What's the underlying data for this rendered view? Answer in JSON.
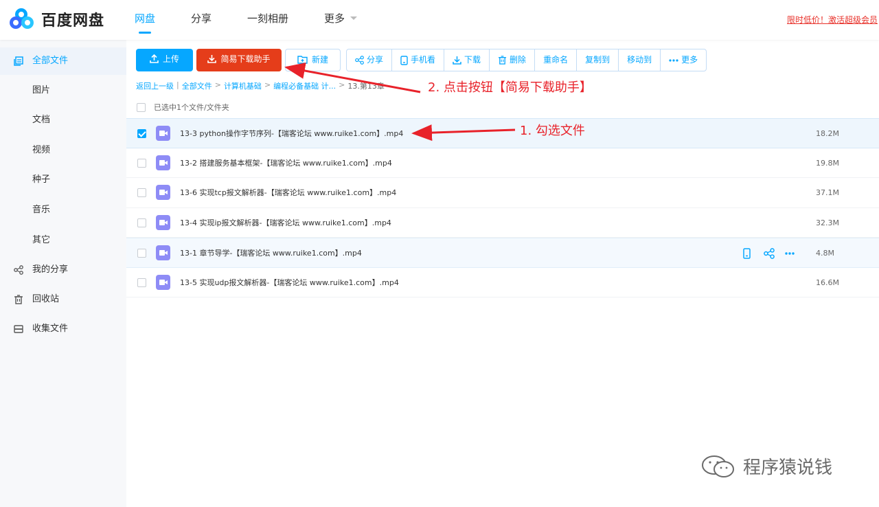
{
  "brand": {
    "name": "百度网盘"
  },
  "nav": {
    "items": [
      "网盘",
      "分享",
      "一刻相册",
      "更多"
    ],
    "active_index": 0
  },
  "promo_text": "限时低价！激活超级会员",
  "sidebar": {
    "items": [
      {
        "label": "全部文件",
        "icon": "folder-icon",
        "active": true
      },
      {
        "label": "图片"
      },
      {
        "label": "文档"
      },
      {
        "label": "视频"
      },
      {
        "label": "种子"
      },
      {
        "label": "音乐"
      },
      {
        "label": "其它"
      },
      {
        "label": "我的分享",
        "icon": "share-icon"
      },
      {
        "label": "回收站",
        "icon": "trash-icon"
      },
      {
        "label": "收集文件",
        "icon": "collect-icon"
      }
    ]
  },
  "toolbar": {
    "upload": "上传",
    "helper": "简易下载助手",
    "new": "新建",
    "group": [
      "分享",
      "手机看",
      "下载",
      "删除",
      "重命名",
      "复制到",
      "移动到",
      "更多"
    ]
  },
  "breadcrumb": {
    "back": "返回上一级",
    "items": [
      "全部文件",
      "计算机基础",
      "编程必备基础 计..."
    ],
    "current": "13.第13章"
  },
  "selection_text": "已选中1个文件/文件夹",
  "files": [
    {
      "name": "13-3 python操作字节序列-【瑞客论坛 www.ruike1.com】.mp4",
      "size": "18.2M",
      "checked": true
    },
    {
      "name": "13-2 搭建服务基本框架-【瑞客论坛 www.ruike1.com】.mp4",
      "size": "19.8M",
      "checked": false
    },
    {
      "name": "13-6 实现tcp报文解析器-【瑞客论坛 www.ruike1.com】.mp4",
      "size": "37.1M",
      "checked": false
    },
    {
      "name": "13-4 实现ip报文解析器-【瑞客论坛 www.ruike1.com】.mp4",
      "size": "32.3M",
      "checked": false
    },
    {
      "name": "13-1 章节导学-【瑞客论坛 www.ruike1.com】.mp4",
      "size": "4.8M",
      "checked": false
    },
    {
      "name": "13-5 实现udp报文解析器-【瑞客论坛 www.ruike1.com】.mp4",
      "size": "16.6M",
      "checked": false
    }
  ],
  "annotations": {
    "step2": "2. 点击按钮【简易下载助手】",
    "step1": "1. 勾选文件"
  },
  "watermark": "程序猿说钱",
  "colors": {
    "accent": "#06a7ff",
    "helper_button": "#e53d1a",
    "annotation": "#e8222a",
    "file_icon": "#8e8cf6"
  }
}
